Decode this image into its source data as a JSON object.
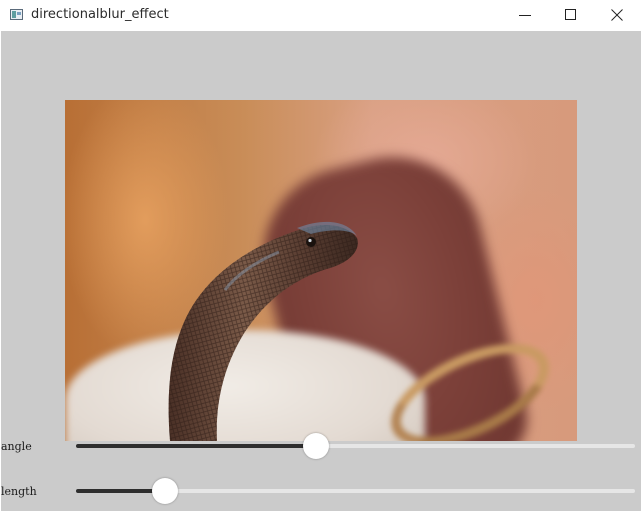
{
  "window": {
    "title": "directionalblur_effect",
    "app_icon": "opencv-window-icon",
    "controls": [
      "minimize-icon",
      "maximize-icon",
      "close-icon"
    ]
  },
  "image": {
    "subject": "snake"
  },
  "trackbars": [
    {
      "label": "angle",
      "value_fraction": 0.43
    },
    {
      "label": "length",
      "value_fraction": 0.16
    }
  ],
  "colors": {
    "client_bg": "#cbcbcb",
    "track": "#e6e6e6",
    "fill": "#2e2e2e",
    "thumb": "#ffffff"
  }
}
